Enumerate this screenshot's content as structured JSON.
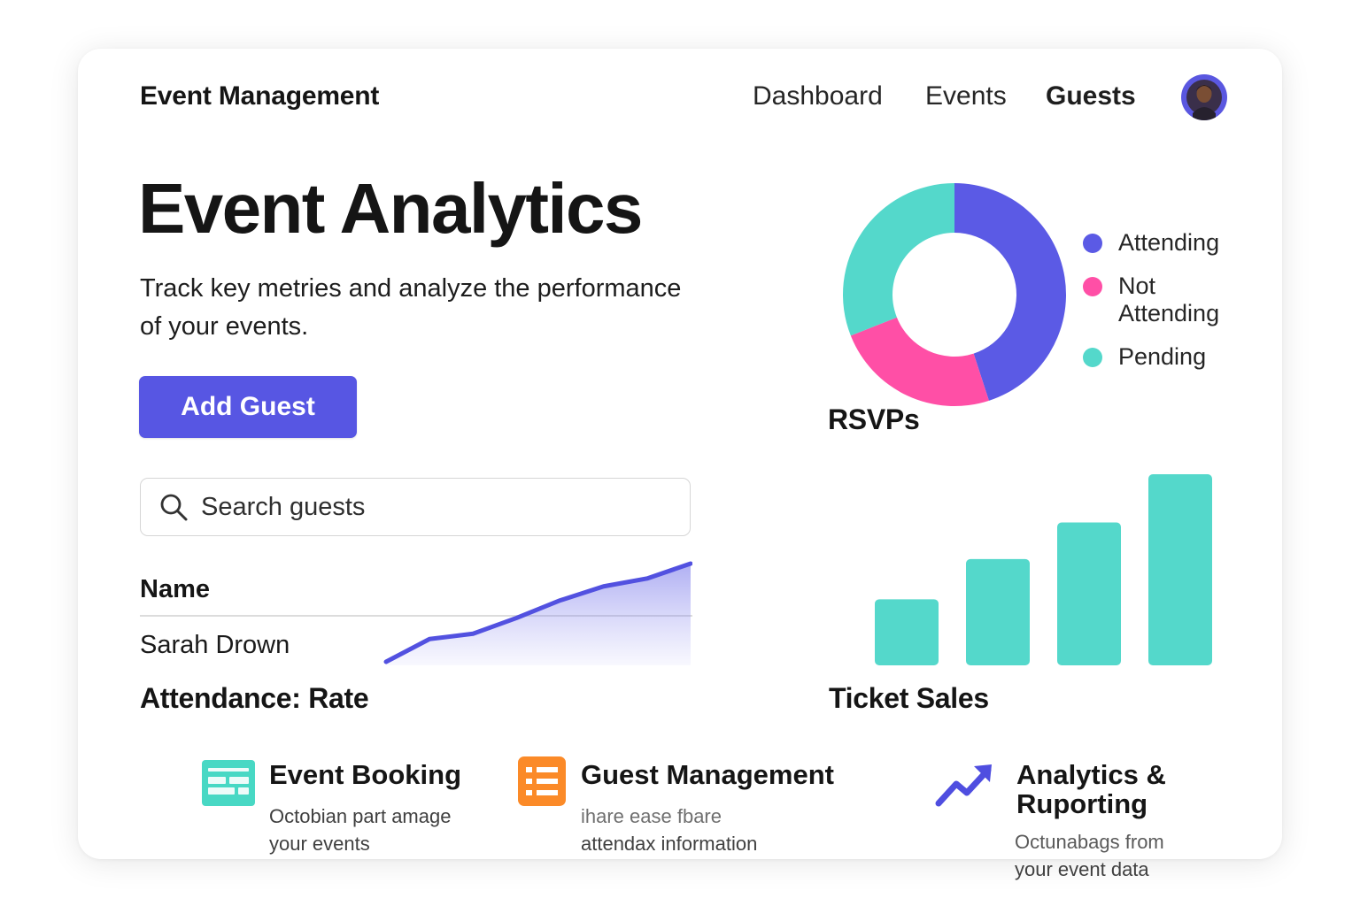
{
  "header": {
    "brand": "Event Management",
    "nav": [
      "Dashboard",
      "Events",
      "Guests"
    ],
    "active_nav": "Guests"
  },
  "hero": {
    "title": "Event Analytics",
    "subtitle_line1": "Track key metries and analyze the performance",
    "subtitle_line2": "of your events.",
    "add_button": "Add Guest"
  },
  "search": {
    "placeholder": "Search guests"
  },
  "table": {
    "header": "Name",
    "rows": [
      "Sarah Drown"
    ]
  },
  "attendance": {
    "title": "Attendance: Rate"
  },
  "rsvp": {
    "title": "RSVPs"
  },
  "ticket_sales": {
    "title": "Ticket Sales"
  },
  "chart_data": [
    {
      "type": "pie",
      "title": "RSVPs",
      "labels": [
        "Attending",
        "Not Attending",
        "Pending"
      ],
      "values": [
        45,
        24,
        31
      ],
      "colors": [
        "#5b5ae5",
        "#ff4fa6",
        "#54d8cb"
      ],
      "legend": "right"
    },
    {
      "type": "area",
      "title": "Attendance: Rate",
      "x": [
        1,
        2,
        3,
        4,
        5,
        6,
        7,
        8
      ],
      "values": [
        0,
        26,
        32,
        50,
        70,
        86,
        95,
        112
      ],
      "color": "#5251e0"
    },
    {
      "type": "bar",
      "title": "Ticket Sales",
      "categories": [
        "1",
        "2",
        "3",
        "4"
      ],
      "values": [
        74,
        119,
        160,
        214
      ],
      "color": "#54d8cb"
    }
  ],
  "features": [
    {
      "icon": "booking-icon",
      "color": "#48d8c4",
      "title": "Event Booking",
      "desc_line1": "Octobian part amage",
      "desc_line2": "your events"
    },
    {
      "icon": "list-icon",
      "color": "#fb8a28",
      "title": "Guest Management",
      "desc_line1": "ihare ease fbare",
      "desc_line2": "attendax information"
    },
    {
      "icon": "trend-up-icon",
      "color": "#4f4ee0",
      "title_line1": "Analytics &",
      "title_line2": "Ruporting",
      "desc_line1": "Octunabags from",
      "desc_line2": "your event data"
    }
  ]
}
